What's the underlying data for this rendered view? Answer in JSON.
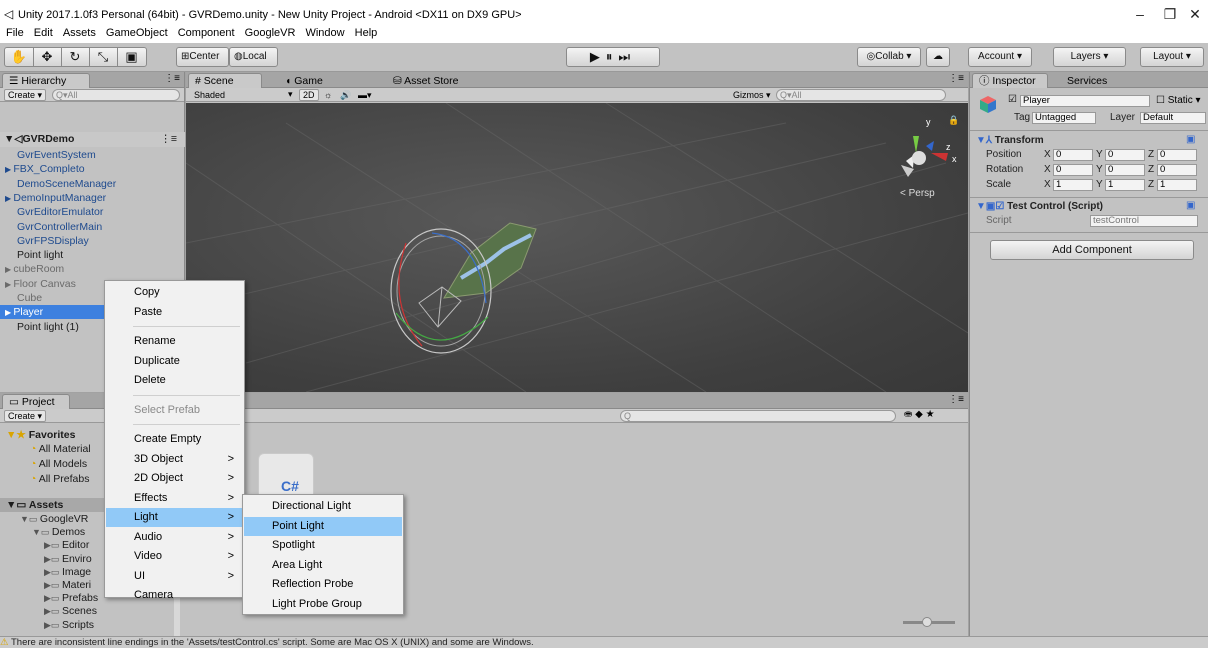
{
  "window": {
    "title": "Unity 2017.1.0f3 Personal (64bit) - GVRDemo.unity - New Unity Project - Android <DX11 on DX9 GPU>",
    "minimize": "–",
    "maximize": "❐",
    "close": "✕"
  },
  "menubar": [
    "File",
    "Edit",
    "Assets",
    "GameObject",
    "Component",
    "GoogleVR",
    "Window",
    "Help"
  ],
  "toolbar": {
    "center_label": "Center",
    "local_label": "Local",
    "collab_label": "Collab ▾",
    "account_label": "Account ▾",
    "layers_label": "Layers ▾",
    "layout_label": "Layout ▾"
  },
  "hierarchy": {
    "tab": "Hierarchy",
    "create": "Create ▾",
    "search_placeholder": "Q▾All",
    "scene": "GVRDemo",
    "items": [
      {
        "label": "GvrEventSystem",
        "style": "blue"
      },
      {
        "label": "FBX_Completo",
        "style": "blue",
        "arrow": true
      },
      {
        "label": "DemoSceneManager",
        "style": "blue"
      },
      {
        "label": "DemoInputManager",
        "style": "blue",
        "arrow": true
      },
      {
        "label": "GvrEditorEmulator",
        "style": "blue"
      },
      {
        "label": "GvrControllerMain",
        "style": "blue"
      },
      {
        "label": "GvrFPSDisplay",
        "style": "blue"
      },
      {
        "label": "Point light",
        "style": "normal"
      },
      {
        "label": "cubeRoom",
        "style": "gray",
        "arrow": true
      },
      {
        "label": "Floor Canvas",
        "style": "gray",
        "arrow": true
      },
      {
        "label": "Cube",
        "style": "gray"
      },
      {
        "label": "Player",
        "style": "selected",
        "arrow": true
      },
      {
        "label": "Point light (1)",
        "style": "normal"
      }
    ]
  },
  "scene_view": {
    "tabs": [
      "Scene",
      "Game",
      "Asset Store"
    ],
    "shading": "Shaded",
    "mode_2d": "2D",
    "gizmos": "Gizmos ▾",
    "search_placeholder": "Q▾All",
    "persp": "Persp"
  },
  "project": {
    "tab": "Project",
    "create": "Create ▾",
    "favorites_label": "Favorites",
    "favorites": [
      "All Material",
      "All Models",
      "All Prefabs"
    ],
    "assets_label": "Assets",
    "tree": [
      {
        "label": "GoogleVR",
        "indent": 1
      },
      {
        "label": "Demos",
        "indent": 2
      },
      {
        "label": "Editor",
        "indent": 3
      },
      {
        "label": "Enviro",
        "indent": 3
      },
      {
        "label": "Image",
        "indent": 3
      },
      {
        "label": "Materi",
        "indent": 3
      },
      {
        "label": "Prefabs",
        "indent": 3
      },
      {
        "label": "Scenes",
        "indent": 3
      },
      {
        "label": "Scripts",
        "indent": 3
      }
    ],
    "file_icon": "C#"
  },
  "inspector": {
    "tab": "Inspector",
    "tab2": "Services",
    "object_name": "Player",
    "static_label": "Static ▾",
    "tag_label": "Tag",
    "tag_value": "Untagged",
    "layer_label": "Layer",
    "layer_value": "Default",
    "transform_title": "Transform",
    "rows": [
      {
        "label": "Position",
        "x": "0",
        "y": "0",
        "z": "0"
      },
      {
        "label": "Rotation",
        "x": "0",
        "y": "0",
        "z": "0"
      },
      {
        "label": "Scale",
        "x": "1",
        "y": "1",
        "z": "1"
      }
    ],
    "script_component": "Test Control (Script)",
    "script_label": "Script",
    "script_value": "testControl",
    "add_component": "Add Component"
  },
  "context_menu": {
    "items": [
      {
        "label": "Copy"
      },
      {
        "label": "Paste"
      },
      {
        "sep": true
      },
      {
        "label": "Rename"
      },
      {
        "label": "Duplicate"
      },
      {
        "label": "Delete"
      },
      {
        "sep": true
      },
      {
        "label": "Select Prefab",
        "disabled": true
      },
      {
        "sep": true
      },
      {
        "label": "Create Empty"
      },
      {
        "label": "3D Object",
        "sub": true
      },
      {
        "label": "2D Object",
        "sub": true
      },
      {
        "label": "Effects",
        "sub": true
      },
      {
        "label": "Light",
        "sub": true,
        "highlight": true
      },
      {
        "label": "Audio",
        "sub": true
      },
      {
        "label": "Video",
        "sub": true
      },
      {
        "label": "UI",
        "sub": true
      },
      {
        "label": "Camera"
      }
    ]
  },
  "light_submenu": {
    "items": [
      {
        "label": "Directional Light"
      },
      {
        "label": "Point Light",
        "highlight": true
      },
      {
        "label": "Spotlight"
      },
      {
        "label": "Area Light"
      },
      {
        "label": "Reflection Probe"
      },
      {
        "label": "Light Probe Group"
      }
    ]
  },
  "status": {
    "message": "There are inconsistent line endings in the 'Assets/testControl.cs' script. Some are Mac OS X (UNIX) and some are Windows."
  }
}
